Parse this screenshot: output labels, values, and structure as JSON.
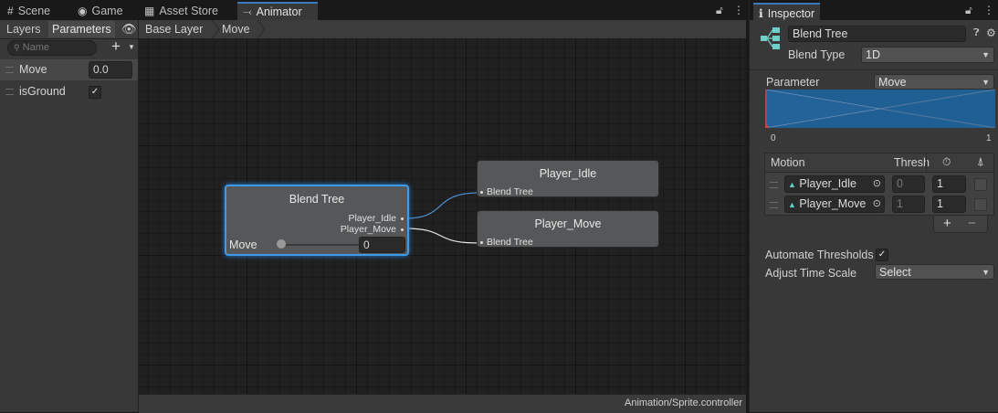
{
  "tabs": [
    {
      "label": "Scene",
      "icon": "grid-icon"
    },
    {
      "label": "Game",
      "icon": "gamepad-icon"
    },
    {
      "label": "Asset Store",
      "icon": "store-icon"
    },
    {
      "label": "Animator",
      "icon": "animator-icon"
    }
  ],
  "params_panel": {
    "subtabs": [
      "Layers",
      "Parameters"
    ],
    "search_placeholder": "Name",
    "params": [
      {
        "name": "Move",
        "type": "float",
        "value": "0.0"
      },
      {
        "name": "isGround",
        "type": "bool",
        "checked": true
      }
    ]
  },
  "breadcrumb": [
    "Base Layer",
    "Move"
  ],
  "graph": {
    "blend_node": {
      "title": "Blend Tree",
      "outputs": [
        "Player_Idle",
        "Player_Move"
      ],
      "param_label": "Move",
      "param_value": "0"
    },
    "motion_nodes": [
      {
        "title": "Player_Idle",
        "input": "Blend Tree"
      },
      {
        "title": "Player_Move",
        "input": "Blend Tree"
      }
    ]
  },
  "status": "Animation/Sprite.controller",
  "inspector": {
    "tab": "Inspector",
    "name_value": "Blend Tree",
    "blend_type_label": "Blend Type",
    "blend_type_value": "1D",
    "parameter_label": "Parameter",
    "parameter_value": "Move",
    "range_min": "0",
    "range_max": "1",
    "table_headers": [
      "Motion",
      "Thresh"
    ],
    "motions": [
      {
        "name": "Player_Idle",
        "threshold": "0",
        "speed": "1"
      },
      {
        "name": "Player_Move",
        "threshold": "1",
        "speed": "1"
      }
    ],
    "plus": "+",
    "minus": "−",
    "automate_label": "Automate Thresholds",
    "automate_checked": true,
    "time_scale_label": "Adjust Time Scale",
    "time_scale_value": "Select"
  },
  "colors": {
    "accent": "#3a79bb",
    "selection": "#3d9be9",
    "blend_fill": "#1f5f94"
  }
}
